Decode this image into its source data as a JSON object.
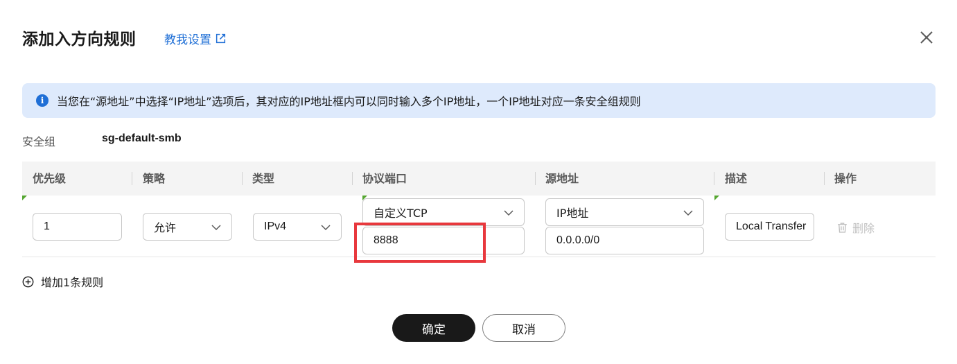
{
  "dialog": {
    "title": "添加入方向规则",
    "help_link": "教我设置",
    "close_icon": "close-icon"
  },
  "banner": {
    "icon": "info-icon",
    "icon_glyph": "i",
    "text": "当您在“源地址”中选择“IP地址”选项后，其对应的IP地址框内可以同时输入多个IP地址，一个IP地址对应一条安全组规则"
  },
  "security_group": {
    "label": "安全组",
    "value": "sg-default-smb"
  },
  "table": {
    "headers": [
      "优先级",
      "策略",
      "类型",
      "协议端口",
      "源地址",
      "描述",
      "操作"
    ],
    "rows": [
      {
        "priority": "1",
        "policy": "允许",
        "type": "IPv4",
        "protocol": "自定义TCP",
        "port": "8888",
        "source_type": "IP地址",
        "source_value": "0.0.0.0/0",
        "description": "Local Transfer",
        "action": "删除"
      }
    ]
  },
  "add_rule": "增加1条规则",
  "buttons": {
    "ok": "确定",
    "cancel": "取消"
  },
  "colors": {
    "accent": "#1f6fd6",
    "highlight": "#e8383d",
    "banner_bg": "#deeafc",
    "primary_button": "#191919",
    "required_marker": "#55a630"
  }
}
